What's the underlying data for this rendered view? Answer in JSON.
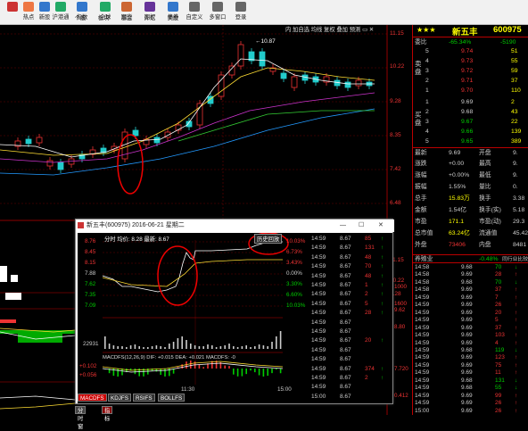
{
  "toolbar": {
    "items": [
      {
        "label": "",
        "color": "#c33"
      },
      {
        "label": "热点",
        "color": "#e74"
      },
      {
        "label": "新股",
        "color": "#37c"
      },
      {
        "label": "沪港通",
        "color": "#2a6"
      },
      {
        "label": "指数",
        "color": "#37c"
      },
      {
        "label": "全球",
        "color": "#2a6"
      },
      {
        "label": "期货",
        "color": "#c63"
      },
      {
        "label": "期权",
        "color": "#639"
      },
      {
        "label": "债券",
        "color": "#37c"
      },
      {
        "label": "自定义",
        "color": "#666"
      },
      {
        "label": "多窗口",
        "color": "#666"
      },
      {
        "label": "登录",
        "color": "#666"
      }
    ],
    "row2": [
      "个股",
      "板块",
      "基金",
      "外汇",
      "美股"
    ]
  },
  "chart": {
    "toolbar": [
      "内",
      "加自选",
      "均线",
      "复权",
      "叠加",
      "预测"
    ],
    "price_labels": [
      "11.15",
      "10.22",
      "9.28",
      "8.35",
      "7.42",
      "6.48"
    ],
    "high_label": "10.87",
    "lower_labels": [
      "11.15",
      "10.22",
      "9.28"
    ]
  },
  "quote": {
    "stars": "★★★",
    "name": "新五丰",
    "code": "600975",
    "wei_bi_label": "委比",
    "wei_bi": "-65.34%",
    "wei_cha": "-5190",
    "sell_label": "卖盘",
    "buy_label": "买盘",
    "sell": [
      {
        "n": "5",
        "p": "9.74",
        "v": "51"
      },
      {
        "n": "4",
        "p": "9.73",
        "v": "55"
      },
      {
        "n": "3",
        "p": "9.72",
        "v": "59"
      },
      {
        "n": "2",
        "p": "9.71",
        "v": "37"
      },
      {
        "n": "1",
        "p": "9.70",
        "v": "110"
      }
    ],
    "buy": [
      {
        "n": "1",
        "p": "9.69",
        "v": "2"
      },
      {
        "n": "2",
        "p": "9.68",
        "v": "43"
      },
      {
        "n": "3",
        "p": "9.67",
        "v": "22"
      },
      {
        "n": "4",
        "p": "9.66",
        "v": "139"
      },
      {
        "n": "5",
        "p": "9.65",
        "v": "389"
      }
    ],
    "stats": [
      {
        "l": "最新",
        "v": "9.69",
        "l2": "开盘",
        "v2": "9."
      },
      {
        "l": "涨跌",
        "v": "+0.00",
        "l2": "最高",
        "v2": "9."
      },
      {
        "l": "涨幅",
        "v": "+0.00%",
        "l2": "最低",
        "v2": "9."
      },
      {
        "l": "振幅",
        "v": "1.55%",
        "l2": "量比",
        "v2": "0."
      },
      {
        "l": "总手",
        "v": "15.83万",
        "l2": "换手",
        "v2": "3.38"
      },
      {
        "l": "金额",
        "v": "1.54亿",
        "l2": "换手(实)",
        "v2": "5.18"
      },
      {
        "l": "市盈",
        "v": "171.1",
        "l2": "市盈(动)",
        "v2": "29.3"
      },
      {
        "l": "总市值",
        "v": "63.24亿",
        "l2": "流通值",
        "v2": "45.42"
      },
      {
        "l": "外盘",
        "v": "73406",
        "l2": "内盘",
        "v2": "8481"
      }
    ],
    "sector_name": "养殖业",
    "sector_pct": "-0.48%",
    "sector_tail": "同行业比较",
    "ticks": [
      {
        "t": "14:58",
        "p": "9.68",
        "v": "70",
        "d": "dn"
      },
      {
        "t": "14:58",
        "p": "9.69",
        "v": "28",
        "d": "up"
      },
      {
        "t": "14:58",
        "p": "9.68",
        "v": "70",
        "d": "dn"
      },
      {
        "t": "14:58",
        "p": "9.69",
        "v": "37",
        "d": "up"
      },
      {
        "t": "14:59",
        "p": "9.69",
        "v": "7",
        "d": "up"
      },
      {
        "t": "14:59",
        "p": "9.69",
        "v": "26",
        "d": "up"
      },
      {
        "t": "14:59",
        "p": "9.69",
        "v": "20",
        "d": "up"
      },
      {
        "t": "14:59",
        "p": "9.69",
        "v": "5",
        "d": "up"
      },
      {
        "t": "14:59",
        "p": "9.69",
        "v": "37",
        "d": "up"
      },
      {
        "t": "14:59",
        "p": "9.69",
        "v": "103",
        "d": "up"
      },
      {
        "t": "14:59",
        "p": "9.69",
        "v": "4",
        "d": "up"
      },
      {
        "t": "14:59",
        "p": "9.68",
        "v": "119",
        "d": "dn"
      },
      {
        "t": "14:59",
        "p": "9.69",
        "v": "123",
        "d": "up"
      },
      {
        "t": "14:59",
        "p": "9.69",
        "v": "75",
        "d": "up"
      },
      {
        "t": "14:59",
        "p": "9.69",
        "v": "11",
        "d": "up"
      },
      {
        "t": "14:59",
        "p": "9.68",
        "v": "131",
        "d": "dn"
      },
      {
        "t": "14:59",
        "p": "9.68",
        "v": "55",
        "d": "dn"
      },
      {
        "t": "14:59",
        "p": "9.69",
        "v": "99",
        "d": "up"
      },
      {
        "t": "14:59",
        "p": "9.69",
        "v": "26",
        "d": "up"
      },
      {
        "t": "15:00",
        "p": "9.69",
        "v": "26",
        "d": "up"
      }
    ]
  },
  "popup": {
    "title": "新五丰(600975) 2016-06-21 星期二",
    "header": "分时 均价: 8.28 最新: 8.67",
    "history_btn": "历史回放",
    "left_axis": [
      "8.76",
      "8.45",
      "8.15",
      "7.88",
      "7.62",
      "7.35",
      "7.09"
    ],
    "right_axis": [
      "10.03%",
      "6.73%",
      "3.43%",
      "0.00%",
      "3.30%",
      "6.60%",
      "10.03%"
    ],
    "vol_label": "22931",
    "macd_vals": [
      "+0.102",
      "+0.056"
    ],
    "macd_text": "MACDFS(12,26,9)  DIF: +0.015  DEA: +0.021  MACDFS: -0",
    "times": [
      "11:30",
      "15:00"
    ],
    "tabs": [
      "MACDFS",
      "KDJFS",
      "RSIFS",
      "BOLLFS"
    ],
    "bottom_tabs": [
      "分时窗",
      "指标"
    ],
    "close_x": "✕",
    "ticks": [
      {
        "t": "14:59",
        "p": "8.67",
        "v": "85",
        "d": "up"
      },
      {
        "t": "14:59",
        "p": "8.67",
        "v": "131",
        "d": "up"
      },
      {
        "t": "14:59",
        "p": "8.67",
        "v": "48",
        "d": "up"
      },
      {
        "t": "14:59",
        "p": "8.67",
        "v": "70",
        "d": "up"
      },
      {
        "t": "14:59",
        "p": "8.67",
        "v": "48",
        "d": "up"
      },
      {
        "t": "14:59",
        "p": "8.67",
        "v": "1",
        "d": "up"
      },
      {
        "t": "14:59",
        "p": "8.67",
        "v": "2",
        "d": "up"
      },
      {
        "t": "14:59",
        "p": "8.67",
        "v": "5",
        "d": "up"
      },
      {
        "t": "14:59",
        "p": "8.67",
        "v": "28",
        "d": "up"
      },
      {
        "t": "14:59",
        "p": "8.67",
        "v": "",
        "d": ""
      },
      {
        "t": "14:59",
        "p": "8.67",
        "v": "",
        "d": ""
      },
      {
        "t": "14:59",
        "p": "8.67",
        "v": "20",
        "d": "up"
      },
      {
        "t": "14:59",
        "p": "8.67",
        "v": "",
        "d": ""
      },
      {
        "t": "14:59",
        "p": "8.67",
        "v": "",
        "d": ""
      },
      {
        "t": "14:59",
        "p": "8.67",
        "v": "374",
        "d": "up"
      },
      {
        "t": "14:59",
        "p": "8.67",
        "v": "2",
        "d": "up"
      },
      {
        "t": "14:59",
        "p": "8.67",
        "v": "",
        "d": ""
      },
      {
        "t": "15:00",
        "p": "8.67",
        "v": "",
        "d": ""
      }
    ],
    "right_extra": [
      "1000",
      "1600",
      "9.62",
      "8.80",
      "7.720",
      "0.412"
    ]
  }
}
